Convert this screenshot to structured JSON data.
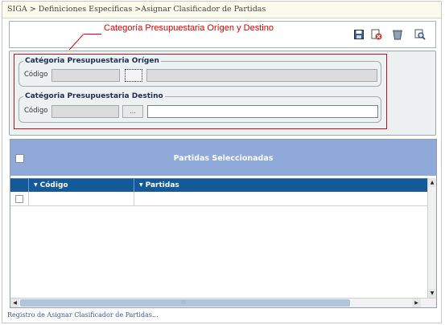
{
  "breadcrumb": "SIGA > Definiciones Especificas >Asignar Clasificador de Partidas",
  "annotation": {
    "label": "Categoría Presupuestaria Orígen y Destino",
    "color": "#e00000"
  },
  "toolbar": {
    "icons": [
      "save-icon",
      "cancel-icon",
      "delete-icon",
      "search-icon"
    ]
  },
  "origen": {
    "legend": "Catégoria Presupuestaria Orígen",
    "code_label": "Código",
    "lookup_label": "",
    "code_value": "",
    "description_value": ""
  },
  "destino": {
    "legend": "Catégoria Presupuestaria Destino",
    "code_label": "Código",
    "lookup_label": "...",
    "code_value": "",
    "description_value": ""
  },
  "grid": {
    "title": "Partidas Seleccionadas",
    "columns": [
      "Código",
      "Partidas"
    ],
    "header_color": "#8fa9d8",
    "column_bar_color": "#145a9a"
  },
  "status": "Registro de Asignar Clasificador de Partidas..."
}
